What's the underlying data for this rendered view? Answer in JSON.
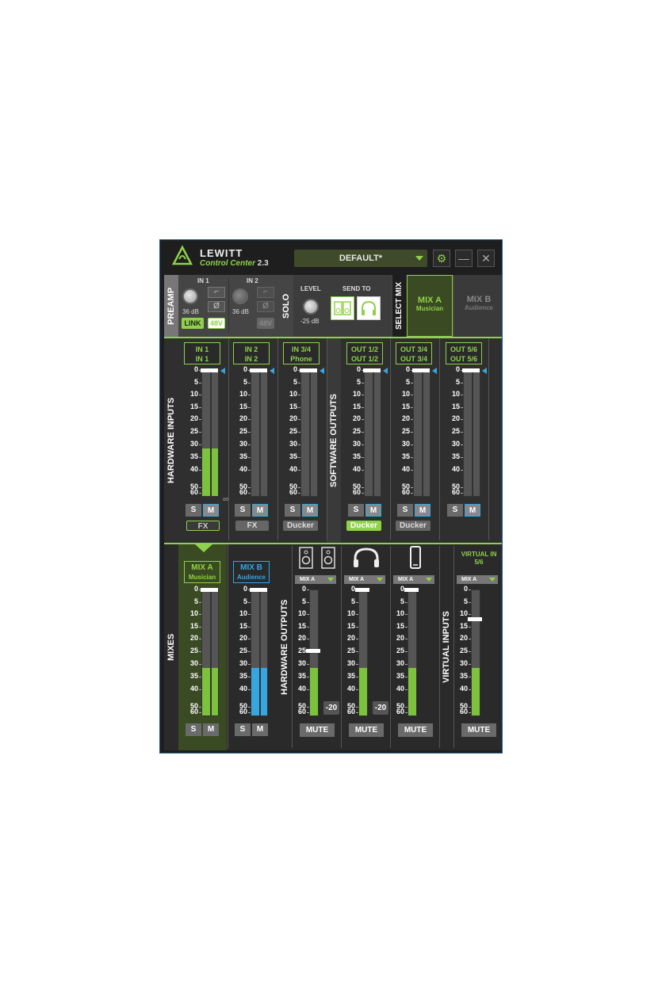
{
  "app": {
    "brand": "LEWITT",
    "product": "Control Center",
    "version": "2.3",
    "preset": "DEFAULT*"
  },
  "preamp": {
    "label": "PREAMP",
    "in1": "IN 1",
    "in2": "IN 2",
    "gain1": "36 dB",
    "gain2": "36 dB",
    "link": "LINK",
    "phantom": "48V",
    "phantom2": "48V",
    "phase": "Ø"
  },
  "solo": {
    "label": "SOLO",
    "level_label": "LEVEL",
    "level": "-25 dB",
    "send_to": "SEND TO"
  },
  "select_mix": {
    "label": "SELECT MIX",
    "mix_a": "MIX A",
    "mix_a_sub": "Musician",
    "mix_b": "MIX B",
    "mix_b_sub": "Audience"
  },
  "hw_inputs_label": "HARDWARE INPUTS",
  "sw_outputs_label": "SOFTWARE OUTPUTS",
  "mixes_label": "MIXES",
  "hw_outputs_label": "HARDWARE OUTPUTS",
  "virtual_inputs_label": "VIRTUAL INPUTS",
  "scale": [
    "0",
    "5",
    "10",
    "15",
    "20",
    "25",
    "30",
    "35",
    "40",
    "50",
    "60"
  ],
  "inputs": [
    {
      "l1": "IN 1",
      "l2": "IN 1",
      "level": 0.38,
      "tag": "FX"
    },
    {
      "l1": "IN 2",
      "l2": "IN 2",
      "level": 0,
      "tag": "FX"
    },
    {
      "l1": "IN 3/4",
      "l2": "Phone",
      "level": 0,
      "tag": "Ducker"
    }
  ],
  "outputs": [
    {
      "l1": "OUT 1/2",
      "l2": "OUT 1/2",
      "level": 0,
      "tag": "Ducker"
    },
    {
      "l1": "OUT 3/4",
      "l2": "OUT 3/4",
      "level": 0,
      "tag": "Ducker"
    },
    {
      "l1": "OUT 5/6",
      "l2": "OUT 5/6",
      "level": 0,
      "tag": ""
    }
  ],
  "s": "S",
  "m": "M",
  "mixes": [
    {
      "l1": "MIX A",
      "l2": "Musician",
      "level": 0.38
    },
    {
      "l1": "MIX B",
      "l2": "Audience",
      "level": 0.38
    }
  ],
  "hwouts": [
    {
      "dd": "MIX A",
      "level": 0.38,
      "db": "-20"
    },
    {
      "dd": "MIX A",
      "level": 0.38,
      "db": "-20"
    },
    {
      "dd": "MIX A",
      "level": 0.38,
      "db": ""
    }
  ],
  "virtual": {
    "title": "VIRTUAL IN 5/6",
    "dd": "MIX A",
    "level": 0.38
  },
  "mute": "MUTE",
  "colors": {
    "accent": "#8fd14a",
    "mixb": "#36a6e0"
  }
}
